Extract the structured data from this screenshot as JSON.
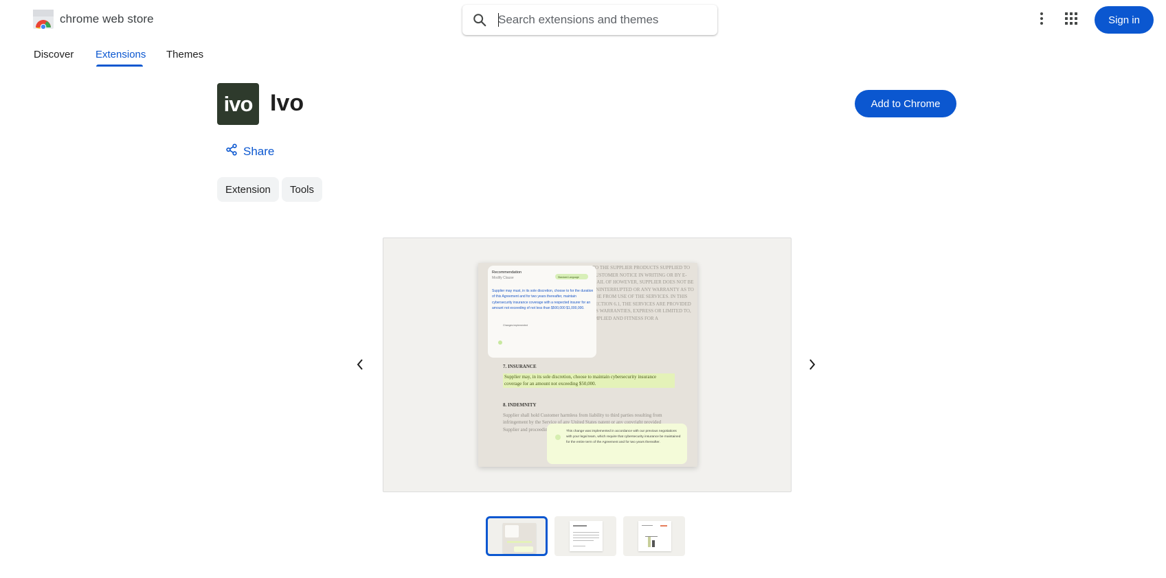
{
  "header": {
    "store_name": "chrome web store",
    "search_placeholder": "Search extensions and themes",
    "more_icon": "more-vert-icon",
    "apps_icon": "apps-grid-icon",
    "signin_label": "Sign in"
  },
  "nav": {
    "tabs": [
      {
        "label": "Discover",
        "active": false
      },
      {
        "label": "Extensions",
        "active": true
      },
      {
        "label": "Themes",
        "active": false
      }
    ]
  },
  "extension": {
    "logo_text": "ivo",
    "title": "Ivo",
    "add_label": "Add to Chrome",
    "share_label": "Share",
    "categories": [
      "Extension",
      "Tools"
    ]
  },
  "carousel": {
    "prev_icon": "chevron-left-icon",
    "next_icon": "chevron-right-icon",
    "active_index": 0,
    "thumbnail_count": 3,
    "screenshot": {
      "card_title": "Recommendation",
      "card_subtitle": "Modify Clause",
      "badge": "Standard Language",
      "clause_text": "Supplier may must, in its sole discretion, choose to for the duration of this Agreement and for two years thereafter, maintain cybersecurity insurance coverage with a respected insurer for an amount not exceeding of not less than $500,000 $1,000,000.",
      "card_footer": "Changes implemented",
      "section7_heading": "7. INSURANCE",
      "section7_text": "Supplier may, in its sole discretion, choose to maintain cybersecurity insurance coverage for an amount not exceeding $50,000.",
      "section8_heading": "8. INDEMNITY",
      "section8_text": "Supplier shall hold Customer harmless from liability to third parties resulting from infringement by the Service of any United States patent or any copyright provided Supplier and proceedings the opportunity to",
      "bg_text": "TO THE SUPPLIER PRODUCTS SUPPLIED TO CUSTOMER NOTICE IN WRITING OR BY E-MAIL OF HOWEVER, SUPPLIER DOES NOT BE UNINTERRUPTED OR ANY WARRANTY AS TO THE FROM USE OF THE SERVICES. IN THIS SECTION 6.1, THE SERVICES ARE PROVIDED AS WARRANTIES, EXPRESS OR LIMITED TO, IMPLIED AND FITNESS FOR A",
      "note_text": "This change was implemented in accordance with our previous negotiations with your legal team, which require that cybersecurity insurance be maintained for the entire term of the Agreement and for two years thereafter."
    }
  },
  "colors": {
    "accent": "#0b57d0",
    "icon_bg": "#2e3a2c",
    "highlight": "#e4f2b8",
    "strike_red": "#d93025",
    "insert_blue": "#1a57c7"
  }
}
